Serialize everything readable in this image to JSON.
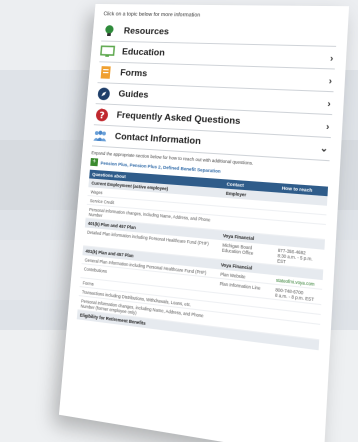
{
  "intro": "Click on a topic below for more information",
  "menu": [
    {
      "label": "Resources",
      "icon": "lightbulb-icon",
      "has_chevron": false
    },
    {
      "label": "Education",
      "icon": "monitor-icon",
      "has_chevron": true
    },
    {
      "label": "Forms",
      "icon": "document-icon",
      "has_chevron": true
    },
    {
      "label": "Guides",
      "icon": "compass-icon",
      "has_chevron": true
    },
    {
      "label": "Frequently Asked Questions",
      "icon": "question-icon",
      "has_chevron": true
    },
    {
      "label": "Contact Information",
      "icon": "people-icon",
      "has_chevron": true
    }
  ],
  "expanded": {
    "help_text": "Expand the appropriate section below for how to reach out with additional questions.",
    "pill_label": "Pension Plus, Pension Plus 2, Defined Benefit Separation",
    "table": {
      "header": [
        "Questions about",
        "Contact",
        "How to reach"
      ],
      "section1": "Current Employment (active employee)",
      "section1_contact": "Employer",
      "section1_rows": [
        "Wages",
        "Service Credit",
        "Personal information changes, including Name, Address, and Phone Number"
      ],
      "section2": "401(k) Plan and 457 Plan",
      "section2_contact": "Voya Financial",
      "section2_rows": [
        "Detailed Plan information including Personal Healthcare Fund (PHF)"
      ],
      "section2_org": "Michigan Board Education Office",
      "section2_phone": "877-358-4682",
      "section2_hours": "8:30 a.m. - 5 p.m. EST",
      "section3": "401(k) Plan and 457 Plan",
      "section3_contact": "Voya Financial",
      "section3_rows": [
        "General Plan Information including Personal Healthcare Fund (PHF)",
        "Contributions",
        "Forms",
        "Transactions including Distributions, Withdrawals, Loans, etc.",
        "Personal information changes, including Name, Address, and Phone Number (former employee only)"
      ],
      "section3_website_label": "Plan Website",
      "section3_website": "stateofmi.voya.com",
      "section3_line_label": "Plan Information Line",
      "section3_phone": "800-748-6700",
      "section3_hours": "8 a.m. - 8 p.m. EST",
      "section4": "Eligibility for Retirement Benefits"
    }
  },
  "colors": {
    "accent_blue": "#2f5c8a",
    "link_green": "#2a7a2a",
    "pill_green": "#3a8a2e"
  }
}
